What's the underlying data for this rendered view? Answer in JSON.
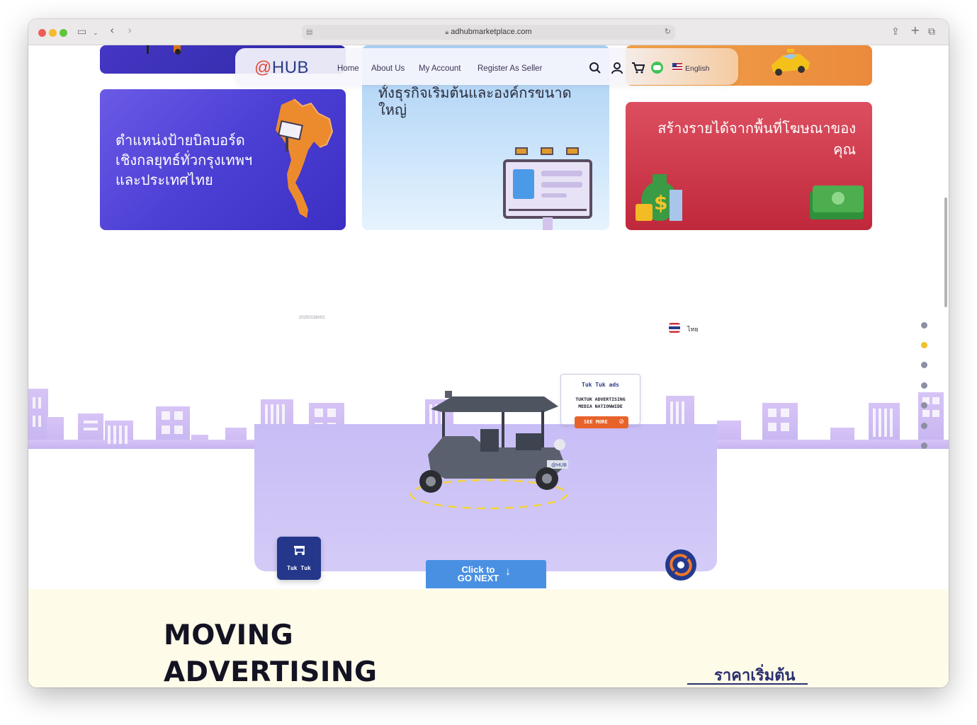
{
  "browser": {
    "url": "adhubmarketplace.com"
  },
  "nav": {
    "logo_text": "HUB",
    "logo_symbol": "@",
    "links": [
      "Home",
      "About Us",
      "My Account",
      "Register As Seller"
    ],
    "language": "English"
  },
  "cards": {
    "billboard": "ตำแหน่งป้ายบิลบอร์ด\nเชิงกลยุทธ์ทั่วกรุงเทพฯ\nและประเทศไทย",
    "business": "ทั้งธุรกิจเริ่มต้นและองค์กรขนาด\nใหญ่",
    "revenue": "สร้างรายได้จากพื้นที่โฆษณาของ\nคุณ"
  },
  "hero": {
    "small_code": "20250138#02",
    "language_thai": "ไทย",
    "bubble_title": "Tuk Tuk ads",
    "bubble_sub1": "TUKTUK ADVERTISING",
    "bubble_sub2": "MEDIA NATIONWIDE",
    "see_more": "SEE MORE",
    "tuktuk_label": "Tuk Tuk",
    "vehicle_badge": "@HUB",
    "next_line1": "Click to",
    "next_line2": "GO NEXT"
  },
  "section": {
    "heading_line1": "MOVING",
    "heading_line2": "ADVERTISING",
    "price_label": "ราคาเริ่มต้น"
  },
  "colors": {
    "navy": "#2d3b87",
    "purple_card": "#5a45d6",
    "red_card": "#c4354a",
    "orange_card": "#eb8a3c",
    "blue_button": "#4a90e2",
    "active_dot": "#f2c028"
  }
}
